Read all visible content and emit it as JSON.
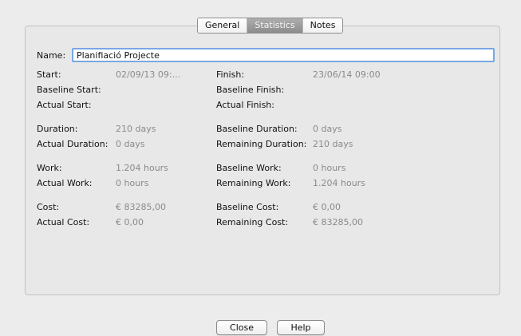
{
  "tabs": [
    "General",
    "Statistics",
    "Notes"
  ],
  "active_tab": "Statistics",
  "name": {
    "label": "Name:",
    "value": "Planifiació Projecte"
  },
  "fields": {
    "start": {
      "label": "Start:",
      "value": "02/09/13 09:..."
    },
    "finish": {
      "label": "Finish:",
      "value": "23/06/14 09:00"
    },
    "baseline_start": {
      "label": "Baseline Start:",
      "value": ""
    },
    "baseline_finish": {
      "label": "Baseline Finish:",
      "value": ""
    },
    "actual_start": {
      "label": "Actual Start:",
      "value": ""
    },
    "actual_finish": {
      "label": "Actual Finish:",
      "value": ""
    },
    "duration": {
      "label": "Duration:",
      "value": "210 days"
    },
    "baseline_duration": {
      "label": "Baseline Duration:",
      "value": "0 days"
    },
    "actual_duration": {
      "label": "Actual Duration:",
      "value": "0 days"
    },
    "remaining_duration": {
      "label": "Remaining Duration:",
      "value": "210 days"
    },
    "work": {
      "label": "Work:",
      "value": "1.204 hours"
    },
    "baseline_work": {
      "label": "Baseline Work:",
      "value": "0 hours"
    },
    "actual_work": {
      "label": "Actual Work:",
      "value": "0 hours"
    },
    "remaining_work": {
      "label": "Remaining Work:",
      "value": "1.204 hours"
    },
    "cost": {
      "label": "Cost:",
      "value": "€ 83285,00"
    },
    "baseline_cost": {
      "label": "Baseline Cost:",
      "value": "€ 0,00"
    },
    "actual_cost": {
      "label": "Actual Cost:",
      "value": "€ 0,00"
    },
    "remaining_cost": {
      "label": "Remaining Cost:",
      "value": "€ 83285,00"
    }
  },
  "buttons": {
    "close": "Close",
    "help": "Help"
  }
}
